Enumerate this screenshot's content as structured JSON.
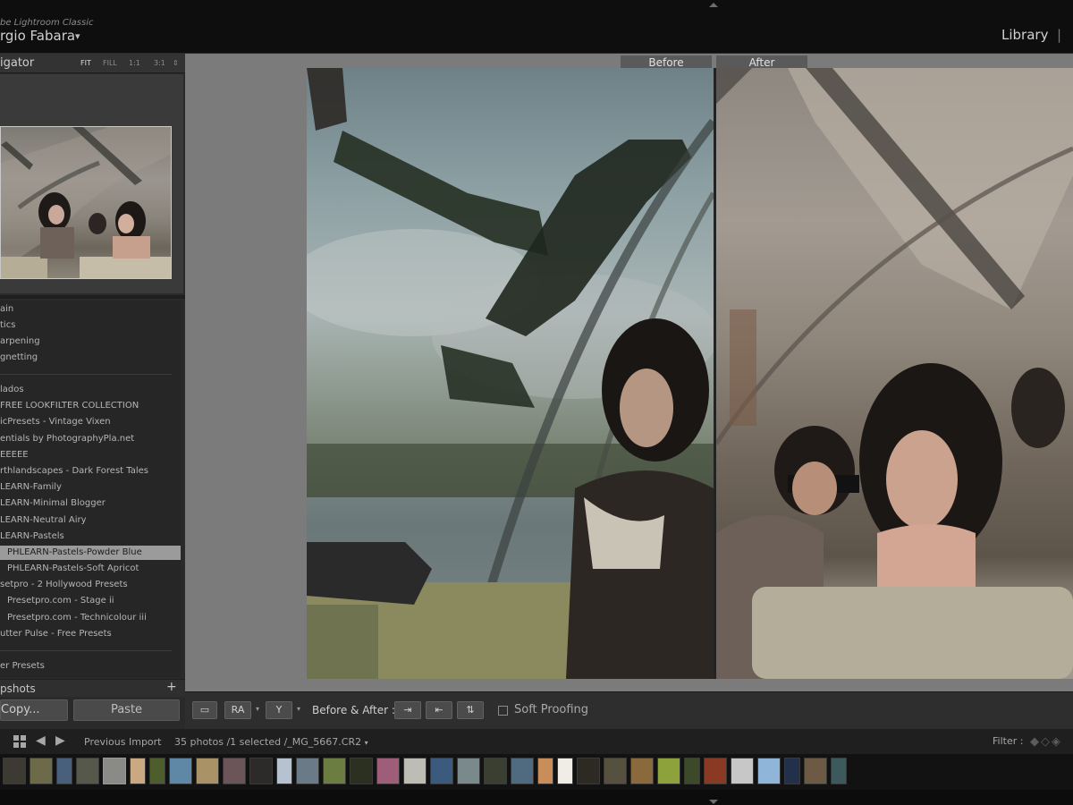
{
  "header": {
    "app_name": "be Lightroom Classic",
    "user_name": "rgio Fabara",
    "user_arrow": "▾",
    "module_active": "Library",
    "module_separator": "|"
  },
  "navigator": {
    "title": "igator",
    "options": [
      "FIT",
      "FILL",
      "1:1",
      "3:1"
    ],
    "zoom_caret": "⇕"
  },
  "presets": {
    "items": [
      {
        "label": "ain"
      },
      {
        "label": "tics"
      },
      {
        "label": "arpening"
      },
      {
        "label": "gnetting"
      },
      {
        "label": "lados"
      },
      {
        "label": "FREE LOOKFILTER COLLECTION"
      },
      {
        "label": "icPresets - Vintage Vixen"
      },
      {
        "label": "entials by PhotographyPla.net"
      },
      {
        "label": "EEEEE"
      },
      {
        "label": "rthlandscapes - Dark Forest Tales"
      },
      {
        "label": "LEARN-Family"
      },
      {
        "label": "LEARN-Minimal Blogger"
      },
      {
        "label": "LEARN-Neutral Airy"
      },
      {
        "label": "LEARN-Pastels"
      },
      {
        "label": "PHLEARN-Pastels-Powder Blue",
        "selected": true
      },
      {
        "label": "PHLEARN-Pastels-Soft Apricot"
      },
      {
        "label": "setpro - 2 Hollywood Presets"
      },
      {
        "label": "Presetpro.com - Stage ii"
      },
      {
        "label": "Presetpro.com - Technicolour iii"
      },
      {
        "label": "utter Pulse - Free Presets"
      },
      {
        "label": "er Presets"
      }
    ]
  },
  "snapshots": {
    "title": "pshots",
    "add": "+"
  },
  "buttons": {
    "copy": "Copy...",
    "paste": "Paste"
  },
  "view": {
    "before_label": "Before",
    "after_label": "After"
  },
  "toolbar": {
    "loupe_icon": "▭",
    "compare_icon": "RA",
    "ba_icon": "Y",
    "ba_text": "Before & After :",
    "copy_after_to_before": "⇥",
    "copy_before_to_after": "⇤",
    "swap": "⇅",
    "soft_proofing": "Soft Proofing",
    "caret": "▾"
  },
  "filmstrip": {
    "back_arrow": "◀",
    "forward_arrow": "▶",
    "source": "Previous Import",
    "count": "35 photos /1 selected /_MG_5667.CR2",
    "count_caret": "▾",
    "filter_label": "Filter :",
    "filter_icons": "◆◇◈",
    "thumb_colors": [
      "#3d3a33",
      "#6c6a48",
      "#49607c",
      "#55584b",
      "#8a8a86",
      "#c9a882",
      "#4d5d2c",
      "#5f87a6",
      "#a89266",
      "#6b5559",
      "#2d2a2a",
      "#b7c2d1",
      "#6a7a86",
      "#6c7d42",
      "#2c3020",
      "#9e5e7a",
      "#bdbdb5",
      "#3b5a7d",
      "#7a8a8c",
      "#3a3f32",
      "#506a80",
      "#c98d5a",
      "#f0ede6",
      "#2d2a24",
      "#56513f",
      "#8a6a3c",
      "#8da23a",
      "#3d4a2a",
      "#8a3a22",
      "#c7c7c7",
      "#8fb5d8",
      "#23304c",
      "#6c5a45",
      "#3c5a5c"
    ],
    "selected_index": 4
  }
}
